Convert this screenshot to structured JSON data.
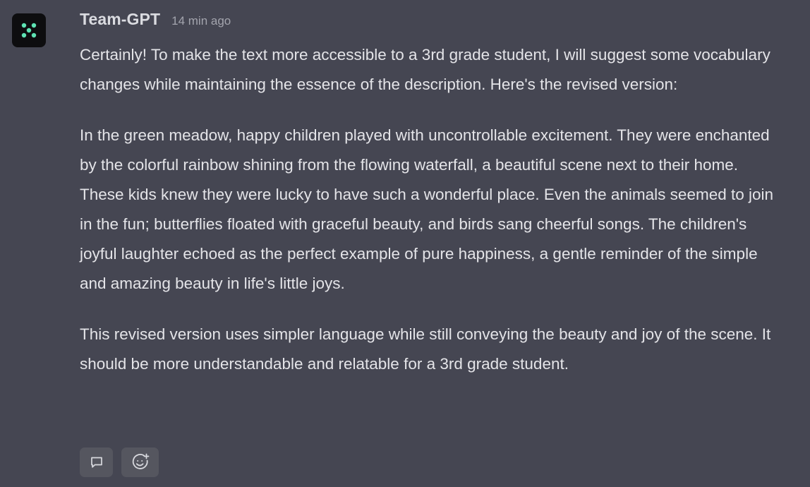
{
  "message": {
    "author": "Team-GPT",
    "timestamp": "14 min ago",
    "avatar_icon": "dice-dots-icon",
    "accent_color": "#5de2b3",
    "paragraphs": [
      "Certainly! To make the text more accessible to a 3rd grade student, I will suggest some vocabulary changes while maintaining the essence of the description. Here's the revised version:",
      "In the green meadow, happy children played with uncontrollable excitement. They were enchanted by the colorful rainbow shining from the flowing waterfall, a beautiful scene next to their home. These kids knew they were lucky to have such a wonderful place. Even the animals seemed to join in the fun; butterflies floated with graceful beauty, and birds sang cheerful songs. The children's joyful laughter echoed as the perfect example of pure happiness, a gentle reminder of the simple and amazing beauty in life's little joys.",
      "This revised version uses simpler language while still conveying the beauty and joy of the scene. It should be more understandable and relatable for a 3rd grade student."
    ]
  },
  "actions": [
    {
      "icon": "comment-icon"
    },
    {
      "icon": "add-reaction-icon"
    }
  ]
}
